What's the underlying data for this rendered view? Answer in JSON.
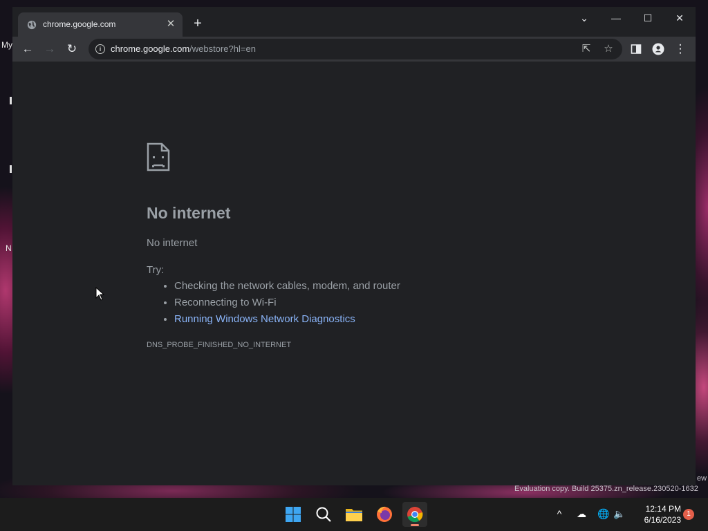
{
  "colors": {
    "accent_link": "#8ab4f8",
    "error_text": "#9aa0a6",
    "page_bg": "#202124",
    "toolbar_bg": "#35363a"
  },
  "desktop": {
    "frag_my": "My",
    "frag_n": "N"
  },
  "tab": {
    "title": "chrome.google.com",
    "icon": "globe-icon"
  },
  "address": {
    "host": "chrome.google.com",
    "path": "/webstore?hl=en"
  },
  "error": {
    "title": "No internet",
    "subtitle": "No internet",
    "try_label": "Try:",
    "suggestions": [
      "Checking the network cables, modem, and router",
      "Reconnecting to Wi-Fi"
    ],
    "link": "Running Windows Network Diagnostics",
    "code": "DNS_PROBE_FINISHED_NO_INTERNET"
  },
  "watermark": {
    "text": "Evaluation copy. Build 25375.zn_release.230520-1632",
    "frag": "ew"
  },
  "taskbar": {
    "time": "12:14 PM",
    "date": "6/16/2023",
    "notification_count": "1",
    "apps": [
      "start-icon",
      "search-icon",
      "file-explorer-icon",
      "firefox-icon",
      "chrome-icon"
    ]
  }
}
